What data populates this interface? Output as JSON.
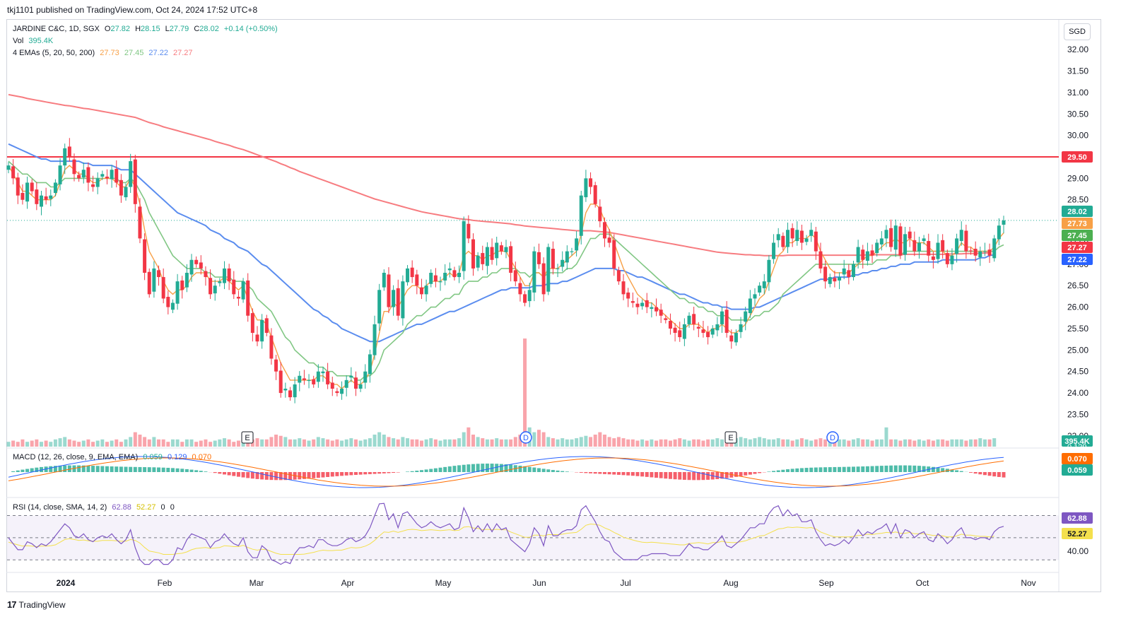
{
  "header": {
    "publish_line": "tkj1101 published on TradingView.com, Oct 24, 2024 17:52 UTC+8"
  },
  "legend": {
    "symbol": "JARDINE C&C, 1D, SGX",
    "ohlc": {
      "o_label": "O",
      "o": "27.82",
      "h_label": "H",
      "h": "28.15",
      "l_label": "L",
      "l": "27.79",
      "c_label": "C",
      "c": "28.02",
      "chg": "+0.14 (+0.50%)"
    },
    "vol_label": "Vol",
    "vol_value": "395.4K",
    "ema_label": "4 EMAs (5, 20, 50, 200)",
    "ema_values": [
      "27.73",
      "27.45",
      "27.22",
      "27.27"
    ],
    "macd_label": "MACD (12, 26, close, 9, EMA, EMA)",
    "macd_values": [
      "0.059",
      "0.129",
      "0.070"
    ],
    "rsi_label": "RSI (14, close, SMA, 14, 2)",
    "rsi_values": [
      "62.88",
      "52.27",
      "0",
      "0"
    ]
  },
  "currency": "SGD",
  "footer": {
    "brand": "TradingView"
  },
  "colors": {
    "up": "#22ab94",
    "down": "#f23645",
    "ema5": "#f7a047",
    "ema20": "#81c784",
    "ema50": "#5b8def",
    "ema200": "#f77c80",
    "hline": "#f23645",
    "rsi": "#7e57c2",
    "rsi_ma": "#f4e04d",
    "macd": "#2962ff",
    "signal": "#ff6d00"
  },
  "chart_data": {
    "type": "candlestick",
    "price_axis": {
      "range": [
        22.75,
        32.2
      ],
      "ticks": [
        "32.00",
        "31.50",
        "31.00",
        "30.50",
        "30.00",
        "29.50",
        "29.00",
        "28.50",
        "28.00",
        "27.50",
        "27.00",
        "26.50",
        "26.00",
        "25.50",
        "25.00",
        "24.50",
        "24.00",
        "23.50",
        "23.00"
      ]
    },
    "time_axis": [
      "2024",
      "Feb",
      "Mar",
      "Apr",
      "May",
      "Jun",
      "Jul",
      "Aug",
      "Sep",
      "Oct",
      "Nov"
    ],
    "closes": [
      29.3,
      29.0,
      28.6,
      28.5,
      28.9,
      28.7,
      28.4,
      28.6,
      28.5,
      28.6,
      28.9,
      29.3,
      29.7,
      29.5,
      29.1,
      29.0,
      29.2,
      28.9,
      28.8,
      29.0,
      29.1,
      29.0,
      29.2,
      28.9,
      28.6,
      28.8,
      29.4,
      28.4,
      27.6,
      26.8,
      26.3,
      26.9,
      26.7,
      26.2,
      26.0,
      26.1,
      26.6,
      26.4,
      26.8,
      27.1,
      27.0,
      26.9,
      26.7,
      26.3,
      26.5,
      26.6,
      26.9,
      26.6,
      26.3,
      26.2,
      26.6,
      25.8,
      25.4,
      25.2,
      25.7,
      25.4,
      24.8,
      24.5,
      24.0,
      24.1,
      23.9,
      24.2,
      24.4,
      24.3,
      24.3,
      24.2,
      24.5,
      24.5,
      24.2,
      24.1,
      24.0,
      24.1,
      24.3,
      24.4,
      24.1,
      24.2,
      24.5,
      24.9,
      25.6,
      26.4,
      26.8,
      26.0,
      26.4,
      25.8,
      26.6,
      26.9,
      26.7,
      26.5,
      26.3,
      26.5,
      26.8,
      26.6,
      26.6,
      26.8,
      26.9,
      26.7,
      26.8,
      28.0,
      27.6,
      26.9,
      27.2,
      27.0,
      27.4,
      27.1,
      27.5,
      27.3,
      27.4,
      26.8,
      26.6,
      26.3,
      26.1,
      26.4,
      27.3,
      27.0,
      26.3,
      27.4,
      26.9,
      26.9,
      27.1,
      27.3,
      27.3,
      27.6,
      28.6,
      29.0,
      28.8,
      28.4,
      28.0,
      27.6,
      27.5,
      26.9,
      26.6,
      26.3,
      26.2,
      26.1,
      26.0,
      26.1,
      26.0,
      26.0,
      25.9,
      25.8,
      25.7,
      25.5,
      25.4,
      25.3,
      25.6,
      25.8,
      25.6,
      25.5,
      25.4,
      25.3,
      25.5,
      25.6,
      25.9,
      25.4,
      25.2,
      25.4,
      25.6,
      25.9,
      26.2,
      26.3,
      26.5,
      26.6,
      27.1,
      27.5,
      27.7,
      27.4,
      27.8,
      27.6,
      27.8,
      27.5,
      27.6,
      27.8,
      27.3,
      26.9,
      26.6,
      26.7,
      26.6,
      26.7,
      26.9,
      26.7,
      27.0,
      27.4,
      27.1,
      27.3,
      27.2,
      27.5,
      27.6,
      27.8,
      27.4,
      27.9,
      27.2,
      27.7,
      27.6,
      27.3,
      27.5,
      27.6,
      27.2,
      27.1,
      27.5,
      27.3,
      27.0,
      27.2,
      27.6,
      27.8,
      27.3,
      27.3,
      27.2,
      27.3,
      27.3,
      27.2,
      27.6,
      27.9,
      28.02
    ],
    "ema5": [
      29.3,
      29.1,
      28.9,
      28.7,
      28.7,
      28.6,
      28.5,
      28.5,
      28.5,
      28.5,
      28.6,
      28.9,
      29.2,
      29.3,
      29.2,
      29.1,
      29.1,
      29.0,
      28.9,
      28.9,
      29.0,
      29.0,
      29.0,
      28.9,
      28.8,
      28.8,
      29.0,
      28.8,
      28.4,
      27.8,
      27.3,
      27.1,
      26.9,
      26.6,
      26.4,
      26.3,
      26.4,
      26.4,
      26.5,
      26.7,
      26.8,
      26.8,
      26.8,
      26.6,
      26.6,
      26.6,
      26.7,
      26.6,
      26.5,
      26.4,
      26.5,
      26.2,
      25.9,
      25.7,
      25.7,
      25.6,
      25.3,
      25.0,
      24.7,
      24.5,
      24.3,
      24.3,
      24.3,
      24.3,
      24.3,
      24.3,
      24.4,
      24.4,
      24.3,
      24.2,
      24.2,
      24.1,
      24.2,
      24.3,
      24.2,
      24.2,
      24.3,
      24.5,
      24.9,
      25.4,
      25.9,
      25.9,
      26.1,
      26.0,
      26.2,
      26.4,
      26.5,
      26.5,
      26.4,
      26.5,
      26.6,
      26.6,
      26.6,
      26.7,
      26.8,
      26.7,
      26.8,
      27.2,
      27.3,
      27.2,
      27.2,
      27.1,
      27.2,
      27.2,
      27.3,
      27.3,
      27.3,
      27.1,
      26.9,
      26.7,
      26.5,
      26.5,
      26.8,
      26.8,
      26.7,
      26.9,
      26.9,
      26.9,
      27.0,
      27.1,
      27.2,
      27.3,
      27.7,
      28.2,
      28.4,
      28.4,
      28.3,
      28.0,
      27.8,
      27.5,
      27.2,
      26.9,
      26.7,
      26.5,
      26.3,
      26.2,
      26.1,
      26.1,
      26.0,
      25.9,
      25.8,
      25.7,
      25.6,
      25.5,
      25.5,
      25.6,
      25.6,
      25.6,
      25.5,
      25.4,
      25.5,
      25.5,
      25.6,
      25.5,
      25.4,
      25.4,
      25.5,
      25.6,
      25.8,
      26.0,
      26.2,
      26.3,
      26.6,
      26.9,
      27.2,
      27.3,
      27.5,
      27.5,
      27.6,
      27.6,
      27.6,
      27.7,
      27.6,
      27.3,
      27.1,
      26.9,
      26.8,
      26.8,
      26.8,
      26.8,
      26.9,
      27.0,
      27.1,
      27.2,
      27.2,
      27.3,
      27.4,
      27.5,
      27.5,
      27.6,
      27.5,
      27.5,
      27.6,
      27.5,
      27.5,
      27.5,
      27.4,
      27.3,
      27.3,
      27.3,
      27.2,
      27.2,
      27.3,
      27.5,
      27.4,
      27.4,
      27.3,
      27.3,
      27.3,
      27.3,
      27.4,
      27.6,
      27.73
    ],
    "ema20": [
      29.4,
      29.3,
      29.2,
      29.1,
      29.1,
      29.0,
      28.9,
      28.9,
      28.9,
      28.8,
      28.8,
      28.9,
      29.0,
      29.0,
      29.0,
      29.0,
      29.0,
      29.0,
      29.0,
      29.0,
      29.0,
      29.0,
      29.0,
      29.0,
      28.9,
      28.9,
      29.0,
      28.9,
      28.7,
      28.5,
      28.2,
      28.0,
      27.8,
      27.6,
      27.4,
      27.2,
      27.1,
      27.0,
      26.9,
      26.9,
      26.9,
      26.9,
      26.8,
      26.8,
      26.7,
      26.7,
      26.7,
      26.7,
      26.6,
      26.6,
      26.6,
      26.5,
      26.4,
      26.2,
      26.1,
      26.0,
      25.9,
      25.7,
      25.5,
      25.3,
      25.2,
      25.0,
      24.9,
      24.8,
      24.7,
      24.7,
      24.6,
      24.6,
      24.5,
      24.5,
      24.4,
      24.4,
      24.4,
      24.4,
      24.3,
      24.3,
      24.4,
      24.4,
      24.5,
      24.7,
      25.0,
      25.1,
      25.2,
      25.3,
      25.4,
      25.6,
      25.7,
      25.8,
      25.8,
      25.9,
      26.0,
      26.0,
      26.1,
      26.2,
      26.2,
      26.3,
      26.3,
      26.5,
      26.6,
      26.6,
      26.6,
      26.7,
      26.7,
      26.8,
      26.8,
      26.9,
      26.9,
      26.9,
      26.9,
      26.8,
      26.8,
      26.7,
      26.8,
      26.8,
      26.7,
      26.8,
      26.8,
      26.8,
      26.8,
      26.9,
      26.9,
      27.0,
      27.2,
      27.4,
      27.6,
      27.6,
      27.7,
      27.7,
      27.7,
      27.6,
      27.5,
      27.4,
      27.3,
      27.2,
      27.1,
      27.0,
      26.9,
      26.8,
      26.7,
      26.6,
      26.5,
      26.4,
      26.3,
      26.2,
      26.2,
      26.1,
      26.1,
      26.0,
      26.0,
      25.9,
      25.9,
      25.8,
      25.8,
      25.8,
      25.7,
      25.7,
      25.7,
      25.7,
      25.7,
      25.8,
      25.8,
      25.9,
      25.9,
      26.0,
      26.1,
      26.3,
      26.4,
      26.5,
      26.6,
      26.7,
      26.8,
      26.9,
      27.0,
      27.0,
      27.0,
      27.0,
      27.0,
      27.0,
      27.0,
      27.0,
      27.0,
      27.0,
      27.0,
      27.0,
      27.0,
      27.1,
      27.1,
      27.1,
      27.2,
      27.2,
      27.2,
      27.3,
      27.3,
      27.3,
      27.3,
      27.3,
      27.3,
      27.3,
      27.3,
      27.3,
      27.3,
      27.3,
      27.3,
      27.3,
      27.3,
      27.3,
      27.3,
      27.3,
      27.3,
      27.3,
      27.3,
      27.4,
      27.45
    ],
    "ema50": [
      29.8,
      29.75,
      29.7,
      29.65,
      29.6,
      29.55,
      29.5,
      29.45,
      29.45,
      29.4,
      29.4,
      29.4,
      29.4,
      29.4,
      29.4,
      29.4,
      29.35,
      29.35,
      29.3,
      29.3,
      29.3,
      29.3,
      29.3,
      29.25,
      29.2,
      29.2,
      29.2,
      29.1,
      29.0,
      28.9,
      28.8,
      28.7,
      28.6,
      28.5,
      28.4,
      28.3,
      28.2,
      28.15,
      28.1,
      28.05,
      28.0,
      27.95,
      27.9,
      27.8,
      27.75,
      27.7,
      27.6,
      27.55,
      27.5,
      27.4,
      27.35,
      27.3,
      27.2,
      27.1,
      27.0,
      26.95,
      26.85,
      26.75,
      26.65,
      26.55,
      26.45,
      26.35,
      26.25,
      26.15,
      26.05,
      25.95,
      25.9,
      25.8,
      25.75,
      25.65,
      25.6,
      25.5,
      25.45,
      25.4,
      25.35,
      25.3,
      25.25,
      25.2,
      25.2,
      25.2,
      25.25,
      25.3,
      25.35,
      25.4,
      25.45,
      25.5,
      25.55,
      25.6,
      25.6,
      25.65,
      25.7,
      25.75,
      25.8,
      25.85,
      25.9,
      25.9,
      25.95,
      26.0,
      26.05,
      26.1,
      26.15,
      26.2,
      26.25,
      26.3,
      26.35,
      26.4,
      26.4,
      26.45,
      26.45,
      26.45,
      26.45,
      26.45,
      26.5,
      26.5,
      26.5,
      26.55,
      26.55,
      26.55,
      26.6,
      26.6,
      26.65,
      26.7,
      26.75,
      26.8,
      26.85,
      26.9,
      26.9,
      26.9,
      26.9,
      26.9,
      26.85,
      26.85,
      26.8,
      26.75,
      26.7,
      26.7,
      26.65,
      26.6,
      26.55,
      26.5,
      26.45,
      26.4,
      26.35,
      26.3,
      26.3,
      26.25,
      26.2,
      26.15,
      26.1,
      26.1,
      26.05,
      26.05,
      26.0,
      26.0,
      25.95,
      25.95,
      25.95,
      25.95,
      25.95,
      26.0,
      26.0,
      26.05,
      26.1,
      26.15,
      26.2,
      26.25,
      26.3,
      26.35,
      26.4,
      26.45,
      26.5,
      26.55,
      26.6,
      26.65,
      26.65,
      26.65,
      26.7,
      26.7,
      26.7,
      26.7,
      26.75,
      26.75,
      26.8,
      26.8,
      26.85,
      26.85,
      26.9,
      26.9,
      26.95,
      26.95,
      27.0,
      27.0,
      27.0,
      27.05,
      27.05,
      27.05,
      27.05,
      27.05,
      27.05,
      27.1,
      27.1,
      27.1,
      27.1,
      27.1,
      27.1,
      27.1,
      27.1,
      27.15,
      27.15,
      27.2,
      27.22
    ],
    "ema200": [
      30.95,
      30.93,
      30.91,
      30.89,
      30.86,
      30.84,
      30.82,
      30.8,
      30.78,
      30.76,
      30.74,
      30.72,
      30.7,
      30.69,
      30.67,
      30.65,
      30.63,
      30.62,
      30.6,
      30.58,
      30.56,
      30.54,
      30.52,
      30.5,
      30.48,
      30.46,
      30.44,
      30.42,
      30.38,
      30.34,
      30.3,
      30.27,
      30.24,
      30.2,
      30.17,
      30.14,
      30.11,
      30.08,
      30.05,
      30.02,
      29.99,
      29.96,
      29.93,
      29.9,
      29.86,
      29.83,
      29.8,
      29.77,
      29.73,
      29.7,
      29.67,
      29.63,
      29.59,
      29.55,
      29.51,
      29.47,
      29.43,
      29.39,
      29.34,
      29.3,
      29.25,
      29.21,
      29.16,
      29.12,
      29.08,
      29.04,
      29.0,
      28.96,
      28.92,
      28.88,
      28.84,
      28.8,
      28.76,
      28.72,
      28.68,
      28.64,
      28.6,
      28.56,
      28.52,
      28.49,
      28.46,
      28.43,
      28.4,
      28.37,
      28.34,
      28.31,
      28.28,
      28.25,
      28.22,
      28.2,
      28.18,
      28.16,
      28.14,
      28.12,
      28.1,
      28.08,
      28.06,
      28.05,
      28.04,
      28.02,
      28.01,
      28.0,
      27.99,
      27.98,
      27.97,
      27.96,
      27.95,
      27.94,
      27.92,
      27.91,
      27.89,
      27.88,
      27.87,
      27.86,
      27.85,
      27.84,
      27.83,
      27.82,
      27.81,
      27.8,
      27.79,
      27.78,
      27.78,
      27.78,
      27.78,
      27.77,
      27.76,
      27.75,
      27.74,
      27.72,
      27.7,
      27.68,
      27.66,
      27.64,
      27.62,
      27.6,
      27.58,
      27.56,
      27.54,
      27.52,
      27.5,
      27.48,
      27.46,
      27.44,
      27.42,
      27.4,
      27.38,
      27.36,
      27.34,
      27.32,
      27.3,
      27.28,
      27.27,
      27.26,
      27.25,
      27.24,
      27.23,
      27.22,
      27.22,
      27.21,
      27.21,
      27.2,
      27.2,
      27.2,
      27.2,
      27.2,
      27.21,
      27.21,
      27.21,
      27.21,
      27.21,
      27.21,
      27.21,
      27.21,
      27.21,
      27.21,
      27.21,
      27.21,
      27.21,
      27.21,
      27.21,
      27.21,
      27.21,
      27.22,
      27.22,
      27.22,
      27.22,
      27.22,
      27.22,
      27.22,
      27.22,
      27.23,
      27.23,
      27.23,
      27.23,
      27.23,
      27.23,
      27.23,
      27.23,
      27.23,
      27.23,
      27.24,
      27.24,
      27.24,
      27.25,
      27.25,
      27.25,
      27.26,
      27.26,
      27.27
    ],
    "volumes": [
      0.2,
      0.25,
      0.2,
      0.3,
      0.2,
      0.25,
      0.3,
      0.2,
      0.25,
      0.2,
      0.3,
      0.35,
      0.4,
      0.3,
      0.25,
      0.2,
      0.25,
      0.3,
      0.2,
      0.25,
      0.3,
      0.2,
      0.25,
      0.3,
      0.2,
      0.3,
      0.4,
      0.6,
      0.5,
      0.4,
      0.3,
      0.4,
      0.3,
      0.3,
      0.2,
      0.3,
      0.3,
      0.2,
      0.3,
      0.3,
      0.2,
      0.25,
      0.3,
      0.2,
      0.25,
      0.3,
      0.35,
      0.3,
      0.2,
      0.25,
      0.3,
      0.4,
      0.3,
      0.35,
      0.3,
      0.3,
      0.4,
      0.5,
      0.45,
      0.4,
      0.3,
      0.3,
      0.35,
      0.3,
      0.25,
      0.3,
      0.4,
      0.35,
      0.3,
      0.25,
      0.3,
      0.25,
      0.3,
      0.35,
      0.3,
      0.25,
      0.3,
      0.35,
      0.5,
      0.6,
      0.5,
      0.4,
      0.35,
      0.3,
      0.4,
      0.35,
      0.3,
      0.3,
      0.25,
      0.3,
      0.35,
      0.3,
      0.25,
      0.3,
      0.3,
      0.3,
      0.35,
      0.6,
      0.8,
      0.5,
      0.4,
      0.35,
      0.3,
      0.3,
      0.35,
      0.3,
      0.3,
      0.3,
      0.4,
      0.5,
      4.5,
      0.8,
      0.6,
      0.7,
      0.6,
      0.4,
      0.35,
      0.3,
      0.35,
      0.3,
      0.3,
      0.35,
      0.4,
      0.45,
      0.4,
      0.5,
      0.6,
      0.5,
      0.4,
      0.35,
      0.4,
      0.35,
      0.3,
      0.3,
      0.25,
      0.3,
      0.25,
      0.3,
      0.25,
      0.3,
      0.3,
      0.25,
      0.3,
      0.35,
      0.3,
      0.25,
      0.3,
      0.3,
      0.25,
      0.3,
      0.3,
      0.35,
      0.3,
      0.25,
      0.3,
      0.35,
      0.4,
      0.35,
      0.3,
      0.35,
      0.4,
      0.35,
      0.3,
      0.3,
      0.35,
      0.3,
      0.3,
      0.25,
      0.3,
      0.35,
      0.3,
      0.25,
      0.3,
      0.35,
      0.3,
      0.3,
      0.25,
      0.3,
      0.3,
      0.25,
      0.3,
      0.35,
      0.3,
      0.3,
      0.25,
      0.3,
      0.3,
      0.8,
      0.3,
      0.3,
      0.25,
      0.3,
      0.3,
      0.25,
      0.3,
      0.25,
      0.3,
      0.25,
      0.3,
      0.3,
      0.25,
      0.3,
      0.3,
      0.3,
      0.25,
      0.3,
      0.3,
      0.35,
      0.3,
      0.3,
      0.35
    ],
    "volume_label": "395.4K",
    "hline": 29.5,
    "hline_label": "29.50",
    "price_labels": [
      "28.02",
      "27.73",
      "27.45",
      "27.27",
      "27.22"
    ],
    "event_markers": [
      {
        "date": "Mar",
        "label": "E"
      },
      {
        "date": "Jun",
        "label": "D"
      },
      {
        "date": "Aug",
        "label": "E"
      },
      {
        "date": "Sep",
        "label": "D"
      }
    ],
    "macd_axis_labels": [
      "0.129",
      "0.070",
      "0.059"
    ],
    "rsi_axis_labels": [
      "62.88",
      "52.27",
      "40.00"
    ],
    "rsi_ylim": [
      20,
      85
    ],
    "rsi_bands": [
      70,
      50,
      30
    ]
  }
}
